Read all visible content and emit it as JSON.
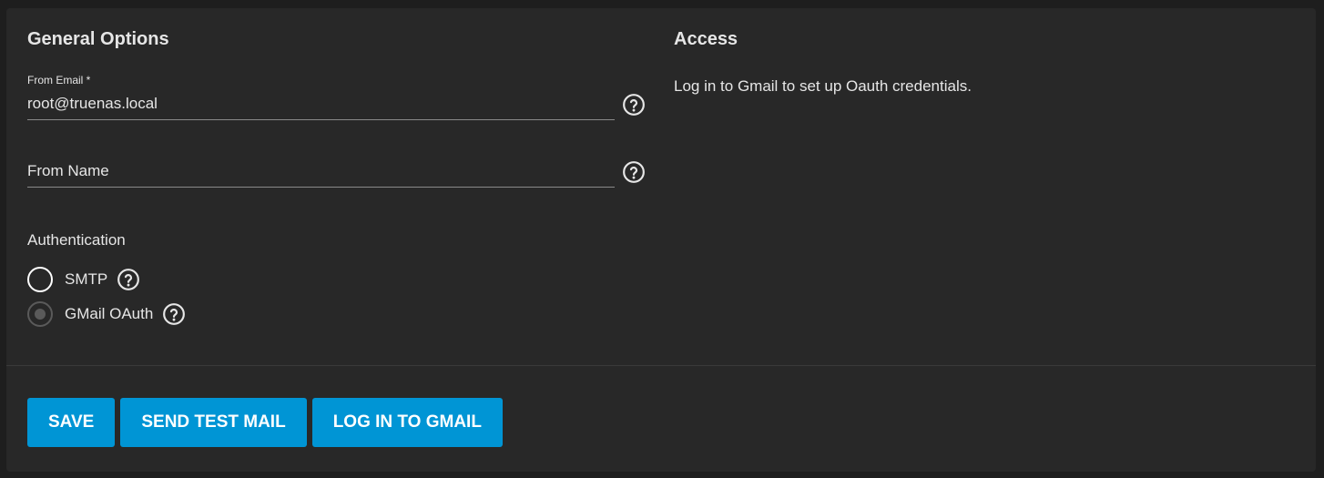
{
  "general": {
    "title": "General Options",
    "from_email_label": "From Email *",
    "from_email_value": "root@truenas.local",
    "from_name_label": "From Name",
    "authentication_label": "Authentication",
    "options": [
      {
        "label": "SMTP",
        "checked": false,
        "disabled": false
      },
      {
        "label": "GMail OAuth",
        "checked": true,
        "disabled": true
      }
    ]
  },
  "access": {
    "title": "Access",
    "message": "Log in to Gmail to set up Oauth credentials."
  },
  "actions": {
    "save_label": "SAVE",
    "send_test_label": "SEND TEST MAIL",
    "login_gmail_label": "LOG IN TO GMAIL"
  },
  "colors": {
    "background": "#1e1e1e",
    "card": "#282828",
    "primary": "#0095d5",
    "text": "#e6e6e6"
  },
  "icons": {
    "help": "help-circle-icon"
  }
}
